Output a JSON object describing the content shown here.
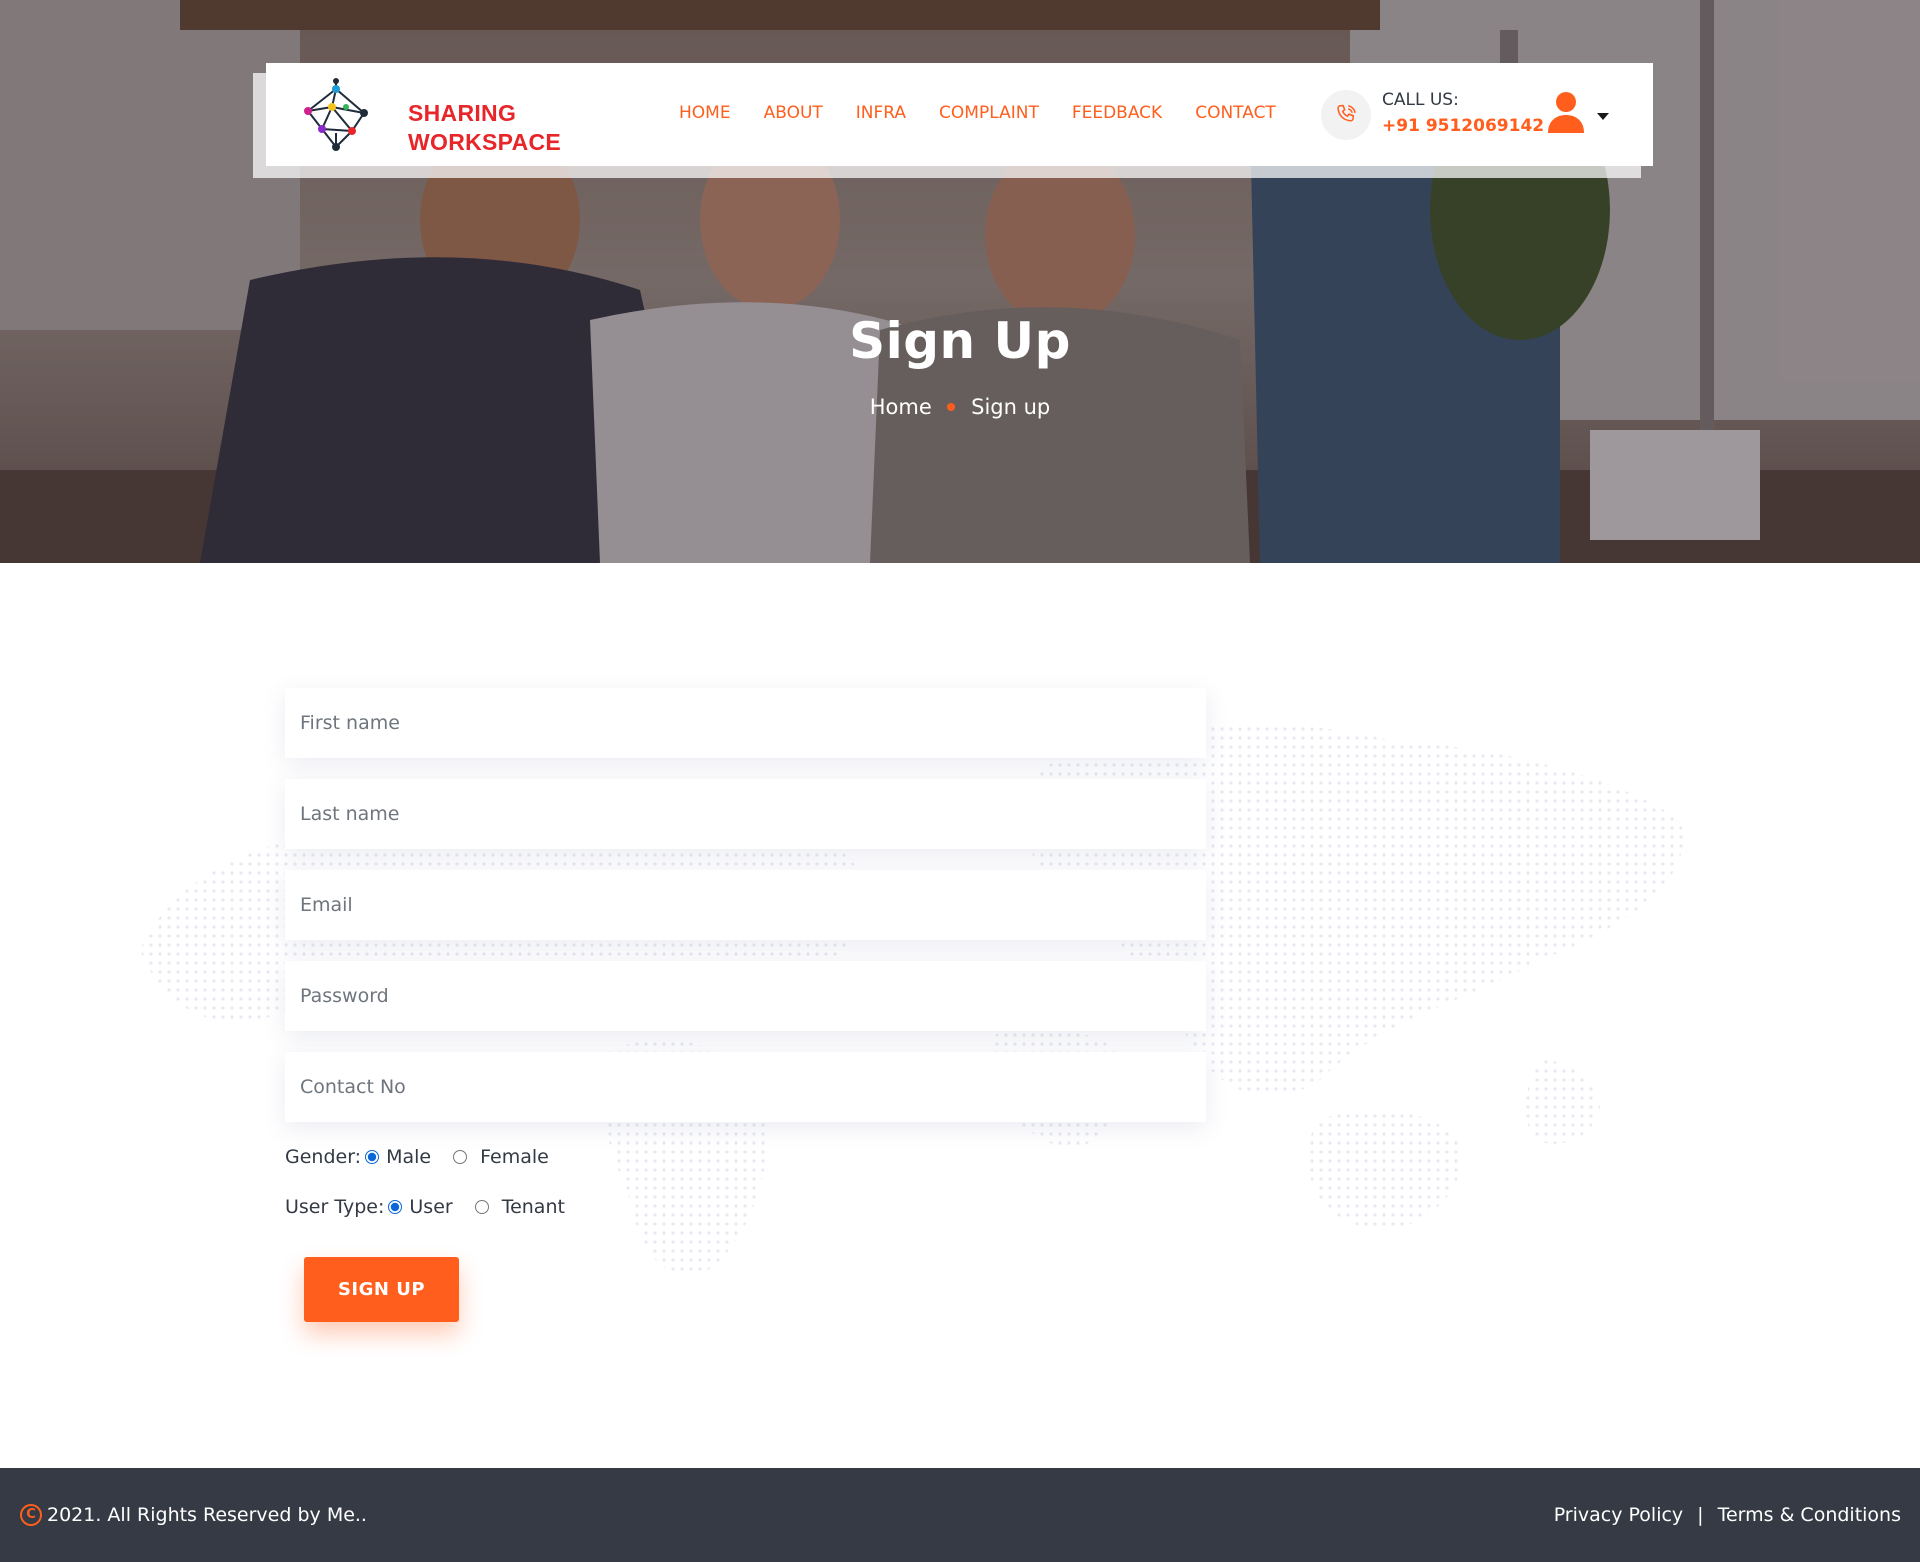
{
  "header": {
    "logo_line1": "SHARING",
    "logo_line2": "WORKSPACE",
    "nav": [
      "HOME",
      "ABOUT",
      "INFRA",
      "COMPLAINT",
      "FEEDBACK",
      "CONTACT"
    ],
    "call_label": "CALL US:",
    "call_number": "+91 9512069142",
    "icons": {
      "phone": "phone-icon",
      "user": "user-icon",
      "dropdown": "caret-down-icon"
    }
  },
  "hero": {
    "title": "Sign Up",
    "breadcrumb_home": "Home",
    "breadcrumb_current": "Sign up"
  },
  "form": {
    "first_name_placeholder": "First name",
    "last_name_placeholder": "Last name",
    "email_placeholder": "Email",
    "password_placeholder": "Password",
    "contact_placeholder": "Contact No",
    "gender_label": "Gender:",
    "gender_options": [
      "Male",
      "Female"
    ],
    "gender_selected": "Male",
    "usertype_label": "User Type:",
    "usertype_options": [
      "User",
      "Tenant"
    ],
    "usertype_selected": "User",
    "submit_label": "SIGN UP"
  },
  "footer": {
    "copyright": "2021. All Rights Reserved by Me..",
    "privacy": "Privacy Policy",
    "separator": "|",
    "terms": "Terms & Conditions"
  },
  "colors": {
    "accent": "#ff5e1d",
    "logo_red": "#e8262a",
    "footer_bg": "#353a44",
    "radio_blue": "#0a66d8"
  }
}
